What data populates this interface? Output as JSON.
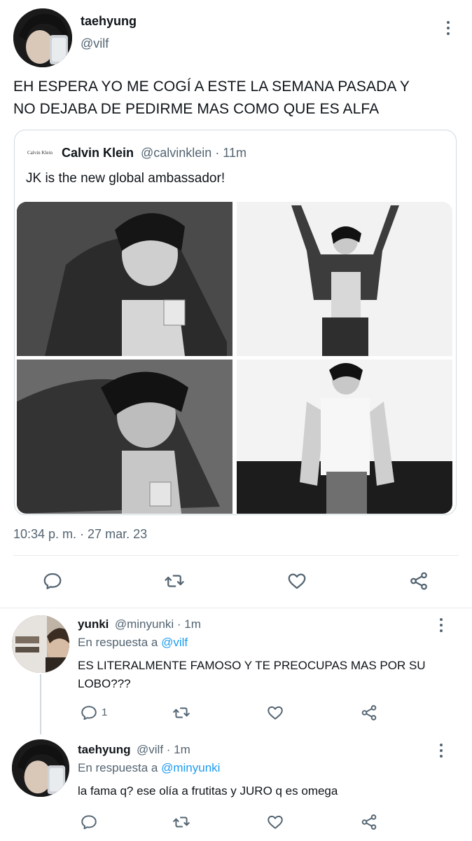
{
  "main_tweet": {
    "name": "taehyung",
    "handle": "@vilf",
    "text_line1": "EH ESPERA YO ME COGÍ A ESTE LA SEMANA PASADA Y",
    "text_line2": "NO DEJABA DE PEDIRME MAS COMO QUE ES ALFA",
    "timestamp": "10:34 p. m. · 27 mar. 23"
  },
  "quoted_tweet": {
    "logo_text": "Calvin Klein",
    "name": "Calvin Klein",
    "handle_time": "@calvinklein · 11m",
    "text": "JK is the new global ambassador!",
    "photo_count": 4
  },
  "replies": [
    {
      "name": "yunki",
      "meta": "@minyunki · 1m",
      "reply_prefix": "En respuesta a",
      "reply_to": "@vilf",
      "text_line1": "ES LITERALMENTE FAMOSO Y TE PREOCUPAS MAS POR SU",
      "text_line2": "LOBO???",
      "reply_count": "1"
    },
    {
      "name": "taehyung",
      "meta": "@vilf · 1m",
      "reply_prefix": "En respuesta a",
      "reply_to": "@minyunki",
      "text_line1": "la fama q? ese olía a frutitas y JURO q es omega"
    }
  ],
  "icons": {
    "reply": "speech-bubble-icon",
    "retweet": "retweet-arrows-icon",
    "like": "heart-icon",
    "share": "share-nodes-icon",
    "more": "vertical-dots-icon"
  },
  "colors": {
    "text": "#0f1419",
    "secondary": "#536471",
    "link": "#1d9bf0",
    "border": "#cfd9de"
  }
}
